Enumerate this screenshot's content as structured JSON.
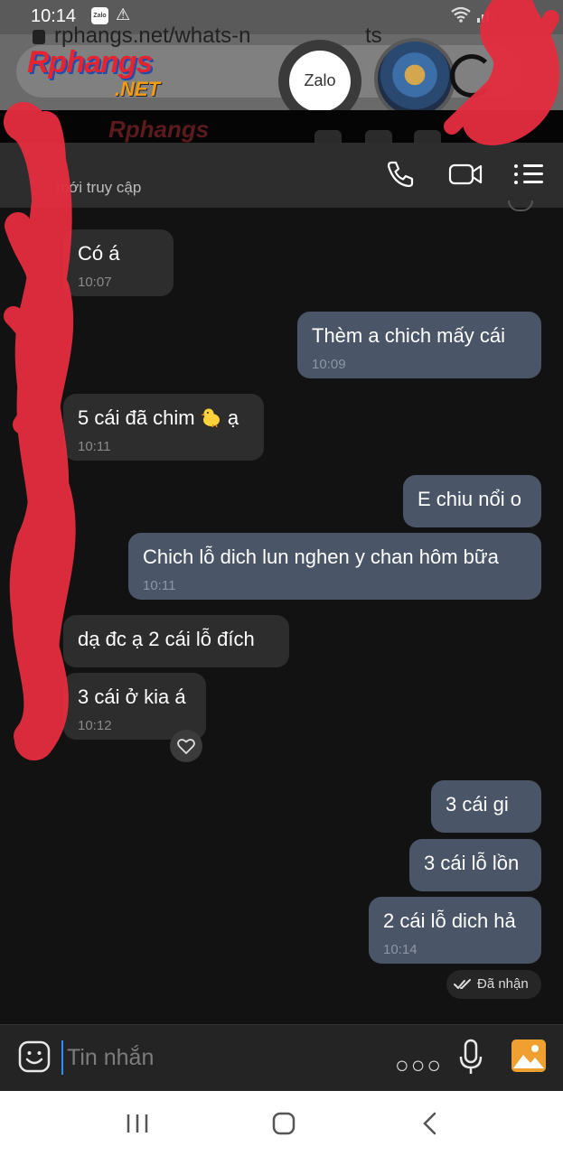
{
  "status_bar": {
    "time": "10:14",
    "app_badge": "Zalo",
    "icons": [
      "zalo-notification-icon",
      "warning-icon",
      "wifi-icon",
      "signal-icon"
    ]
  },
  "browser": {
    "url_text": "rphangs.net/whats-n",
    "url_tail": "ts",
    "brand_main": "Rphangs",
    "brand_suffix": ".NET",
    "bubble_label": "Zalo",
    "strip_brand": "Rphangs"
  },
  "chat": {
    "subtitle": "mới truy cập",
    "actions": [
      "phone-icon",
      "video-call-icon",
      "menu-icon"
    ],
    "messages": [
      {
        "dir": "in",
        "text": "Có á",
        "time": "10:07"
      },
      {
        "dir": "out",
        "text": "Thèm a chich mấy cái",
        "time": "10:09"
      },
      {
        "dir": "in",
        "text": "5 cái đã chim",
        "emoji": "chick-emoji",
        "text_after": "ạ",
        "time": "10:11"
      },
      {
        "dir": "out",
        "text": "E chiu nổi o",
        "time": ""
      },
      {
        "dir": "out",
        "text": "Chich lỗ dich lun nghen y chan hôm bữa",
        "time": "10:11"
      },
      {
        "dir": "in",
        "text": "dạ đc ạ 2 cái lỗ đích",
        "time": ""
      },
      {
        "dir": "in",
        "text": "3 cái ở kia á",
        "time": "10:12",
        "reaction": "heart-icon"
      },
      {
        "dir": "out",
        "text": "3 cái gi",
        "time": ""
      },
      {
        "dir": "out",
        "text": "3 cái lỗ lồn",
        "time": ""
      },
      {
        "dir": "out",
        "text": "2 cái lỗ dich hả",
        "time": "10:14"
      }
    ],
    "delivery_status": "Đã nhận"
  },
  "composer": {
    "placeholder": "Tin nhắn",
    "value": "",
    "icons": [
      "sticker-icon",
      "more-icon",
      "microphone-icon",
      "image-icon"
    ]
  },
  "colors": {
    "background": "#121212",
    "incoming_bubble": "#2d2d2d",
    "outgoing_bubble": "#4a5568",
    "redaction": "#e32d3f",
    "image_icon": "#f0a030"
  }
}
